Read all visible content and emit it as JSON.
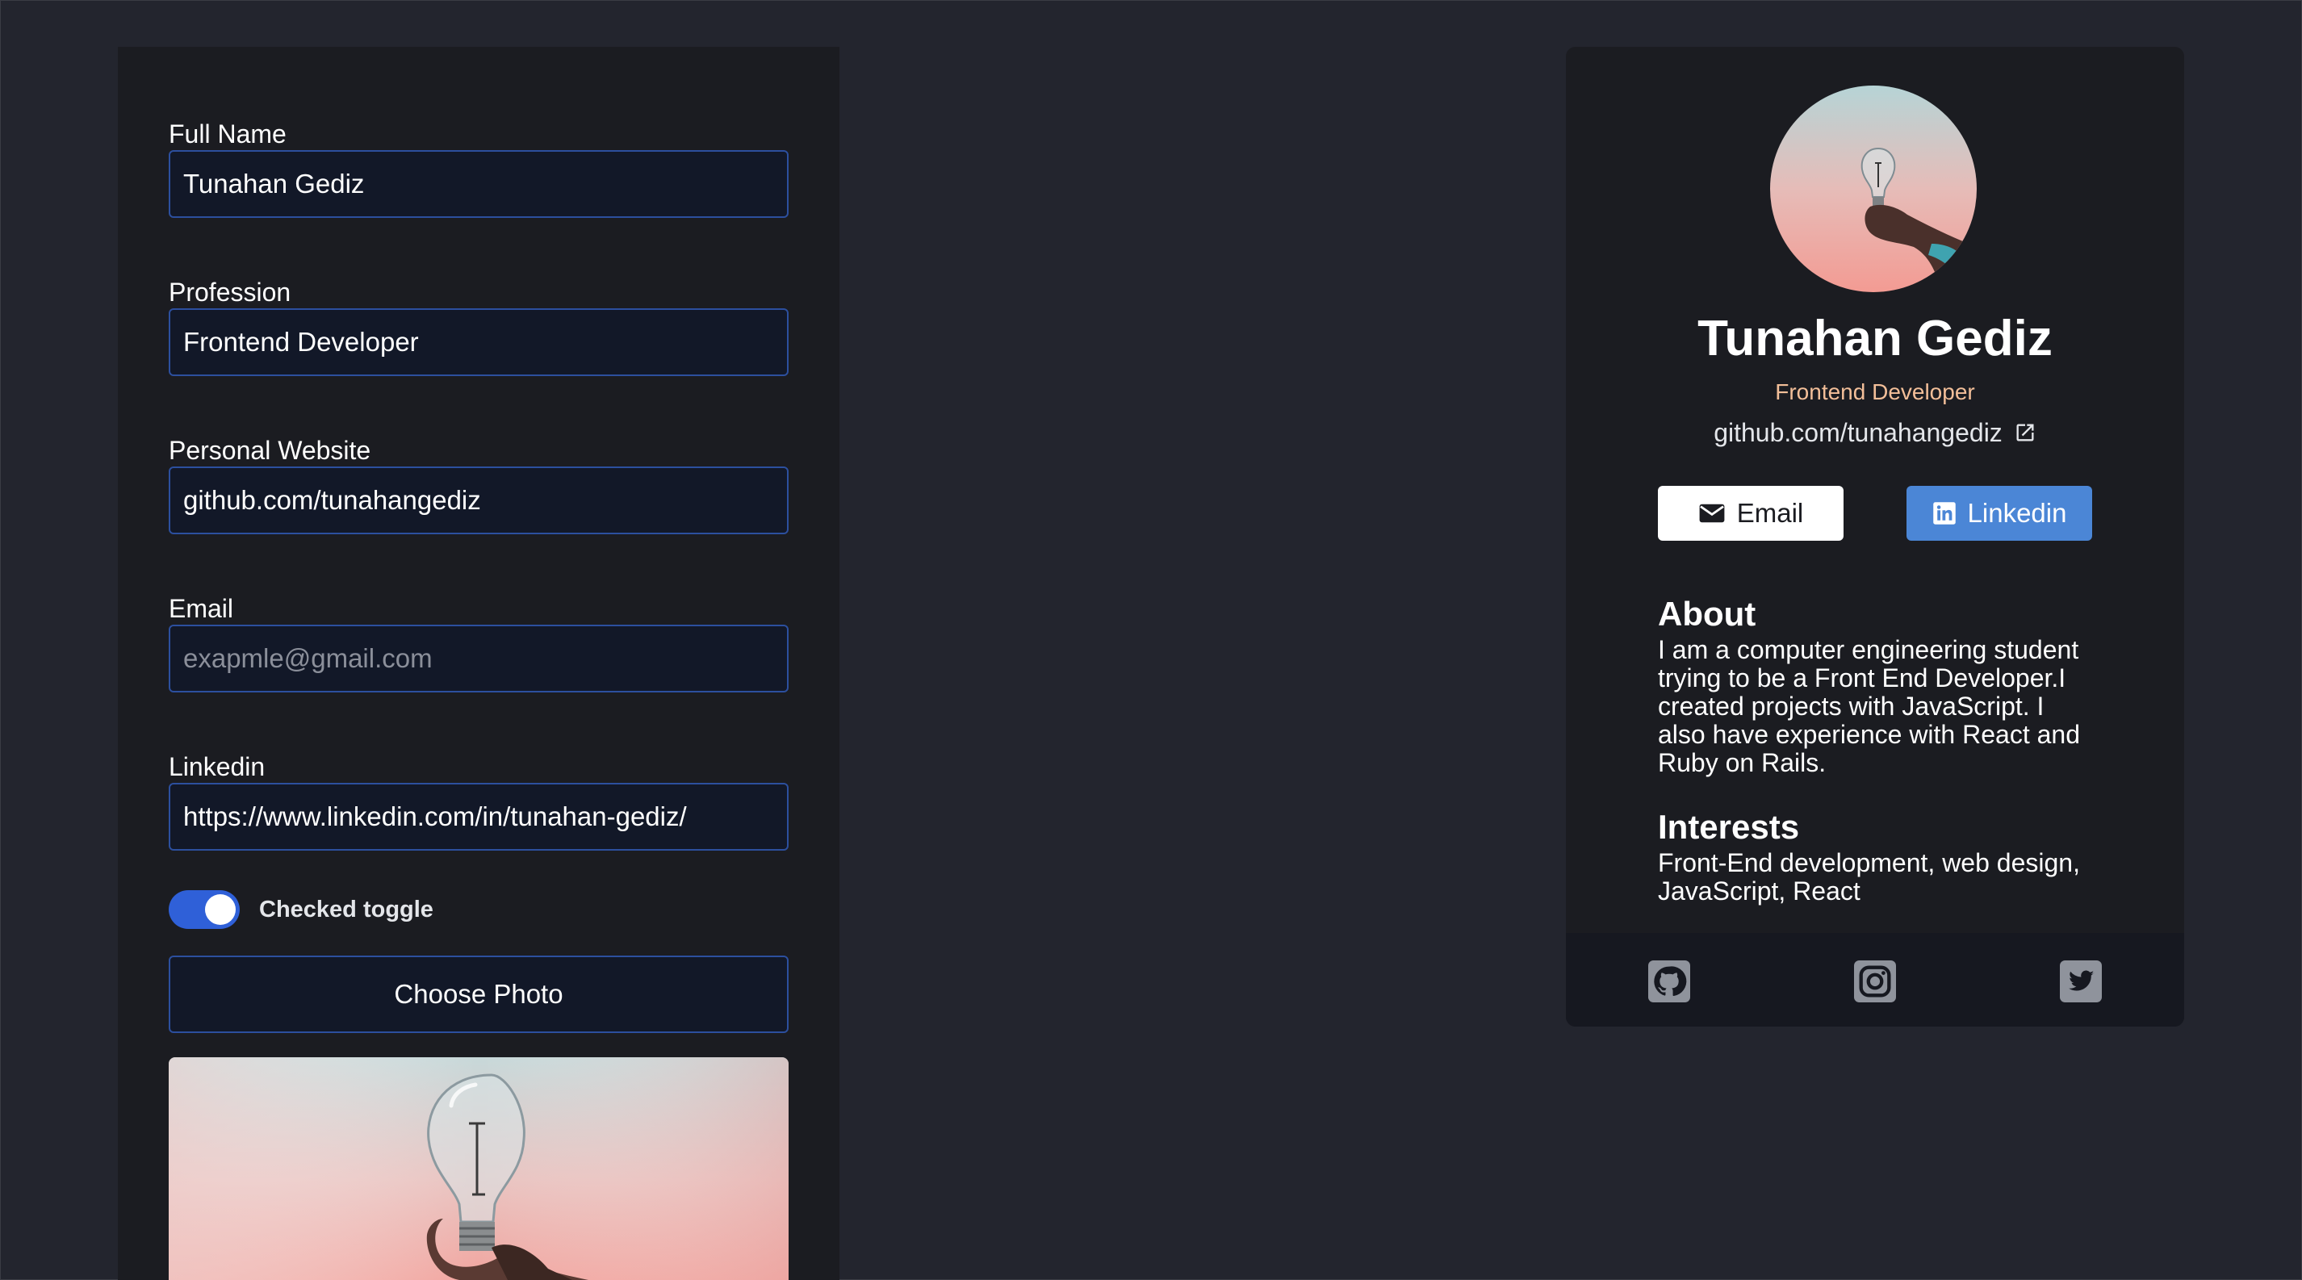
{
  "form": {
    "full_name": {
      "label": "Full Name",
      "value": "Tunahan Gediz"
    },
    "profession": {
      "label": "Profession",
      "value": "Frontend Developer"
    },
    "website": {
      "label": "Personal Website",
      "value": "github.com/tunahangediz"
    },
    "email": {
      "label": "Email",
      "value": "",
      "placeholder": "exapmle@gmail.com"
    },
    "linkedin": {
      "label": "Linkedin",
      "value": "https://www.linkedin.com/in/tunahan-gediz/"
    },
    "toggle": {
      "label": "Checked toggle",
      "checked": true
    },
    "choose_photo_label": "Choose Photo"
  },
  "card": {
    "name": "Tunahan Gediz",
    "profession": "Frontend Developer",
    "website": "github.com/tunahangediz",
    "email_button": "Email",
    "linkedin_button": "Linkedin",
    "about_title": "About",
    "about_text": "I am a computer engineering student trying to be a Front End Developer.I created projects with JavaScript. I also have experience with React and Ruby on Rails.",
    "interests_title": "Interests",
    "interests_text": "Front-End development, web design, JavaScript, React",
    "socials": [
      "github-icon",
      "instagram-icon",
      "twitter-icon"
    ]
  },
  "colors": {
    "background": "#23252e",
    "panel": "#1b1c21",
    "input_bg": "#121828",
    "input_border": "#2c4f9e",
    "toggle_on": "#2f60d8",
    "accent_profession": "#f3bf99",
    "linkedin_button": "#4b86d6",
    "footer": "#161820"
  }
}
